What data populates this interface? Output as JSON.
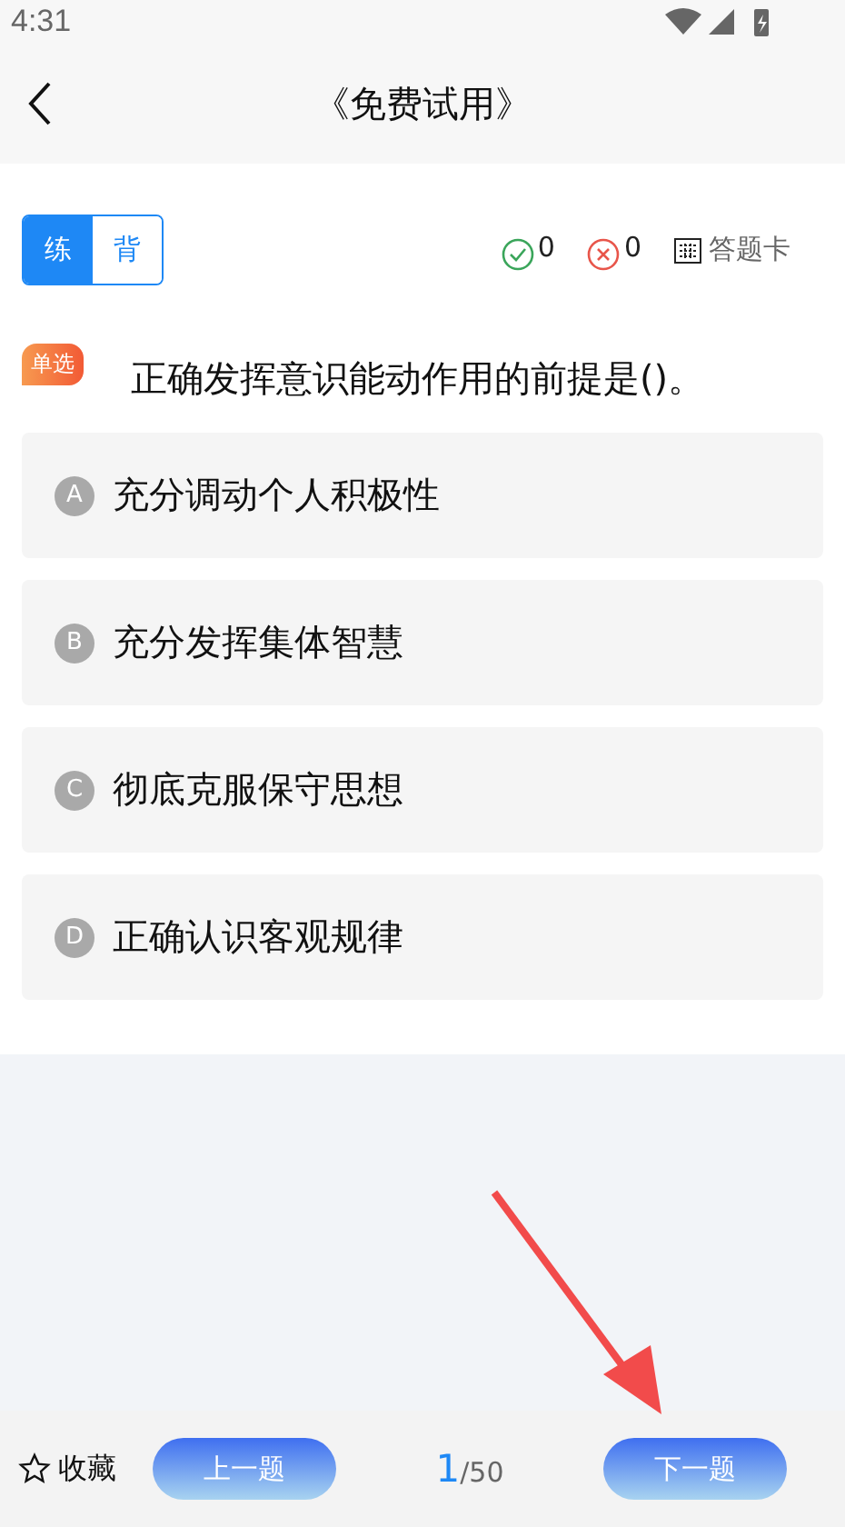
{
  "status_bar": {
    "time": "4:31"
  },
  "header": {
    "title": "《免费试用》"
  },
  "mode_tabs": [
    {
      "label": "练",
      "selected": true
    },
    {
      "label": "背",
      "selected": false
    }
  ],
  "stats": {
    "correct": "0",
    "wrong": "0",
    "answer_card": "答题卡"
  },
  "question": {
    "type_badge": "单选",
    "text": "正确发挥意识能动作用的前提是()。"
  },
  "options": [
    {
      "letter": "A",
      "text": "充分调动个人积极性",
      "selected": false
    },
    {
      "letter": "B",
      "text": "充分发挥集体智慧",
      "selected": false
    },
    {
      "letter": "C",
      "text": "彻底克服保守思想",
      "selected": false
    },
    {
      "letter": "D",
      "text": "正确认识客观规律",
      "selected": false
    }
  ],
  "bottom_bar": {
    "favorite": "收藏",
    "prev": "上一题",
    "current": "1",
    "total": "/50",
    "next": "下一题"
  }
}
